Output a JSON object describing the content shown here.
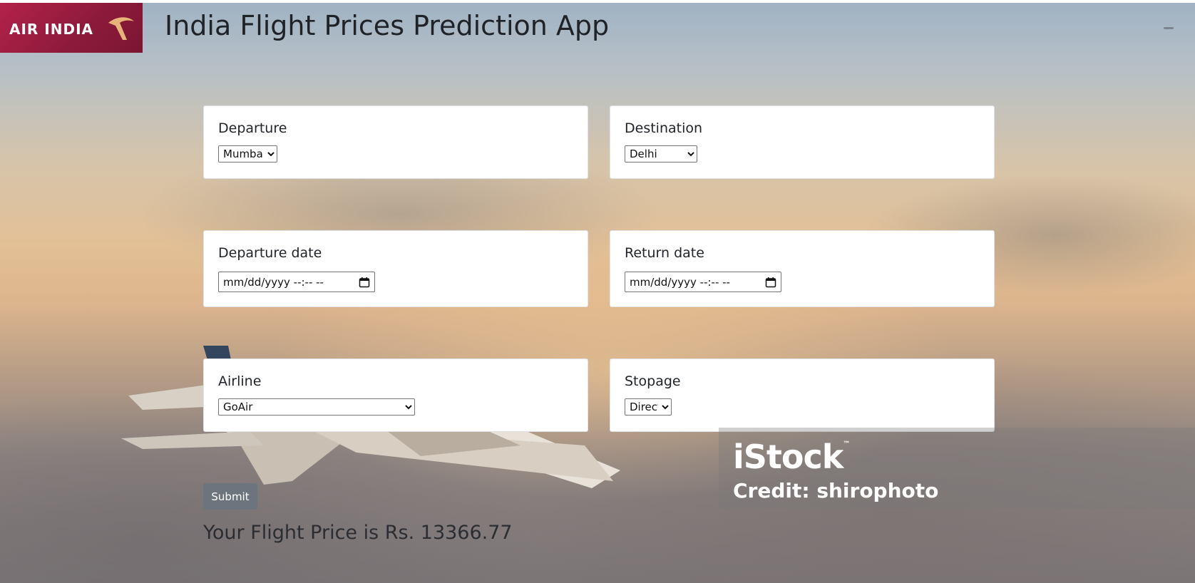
{
  "header": {
    "logo_text": "AIR INDIA",
    "title": "India Flight Prices Prediction App"
  },
  "form": {
    "departure": {
      "label": "Departure",
      "selected": "Mumbai"
    },
    "destination": {
      "label": "Destination",
      "selected": "Delhi"
    },
    "departure_date": {
      "label": "Departure date",
      "value": "mm/dd/yyyy  --:-- --"
    },
    "return_date": {
      "label": "Return date",
      "value": "mm/dd/yyyy  --:-- --"
    },
    "airline": {
      "label": "Airline",
      "selected": "GoAir"
    },
    "stopage": {
      "label": "Stopage",
      "selected": "Direct"
    },
    "submit_label": "Submit"
  },
  "result": {
    "text": "Your Flight Price is Rs. 13366.77"
  },
  "watermark": {
    "brand": "iStock",
    "tm": "™",
    "credit": "Credit: shirophoto"
  },
  "colors": {
    "brand": "#8c1a3a",
    "button": "#6c757d"
  }
}
